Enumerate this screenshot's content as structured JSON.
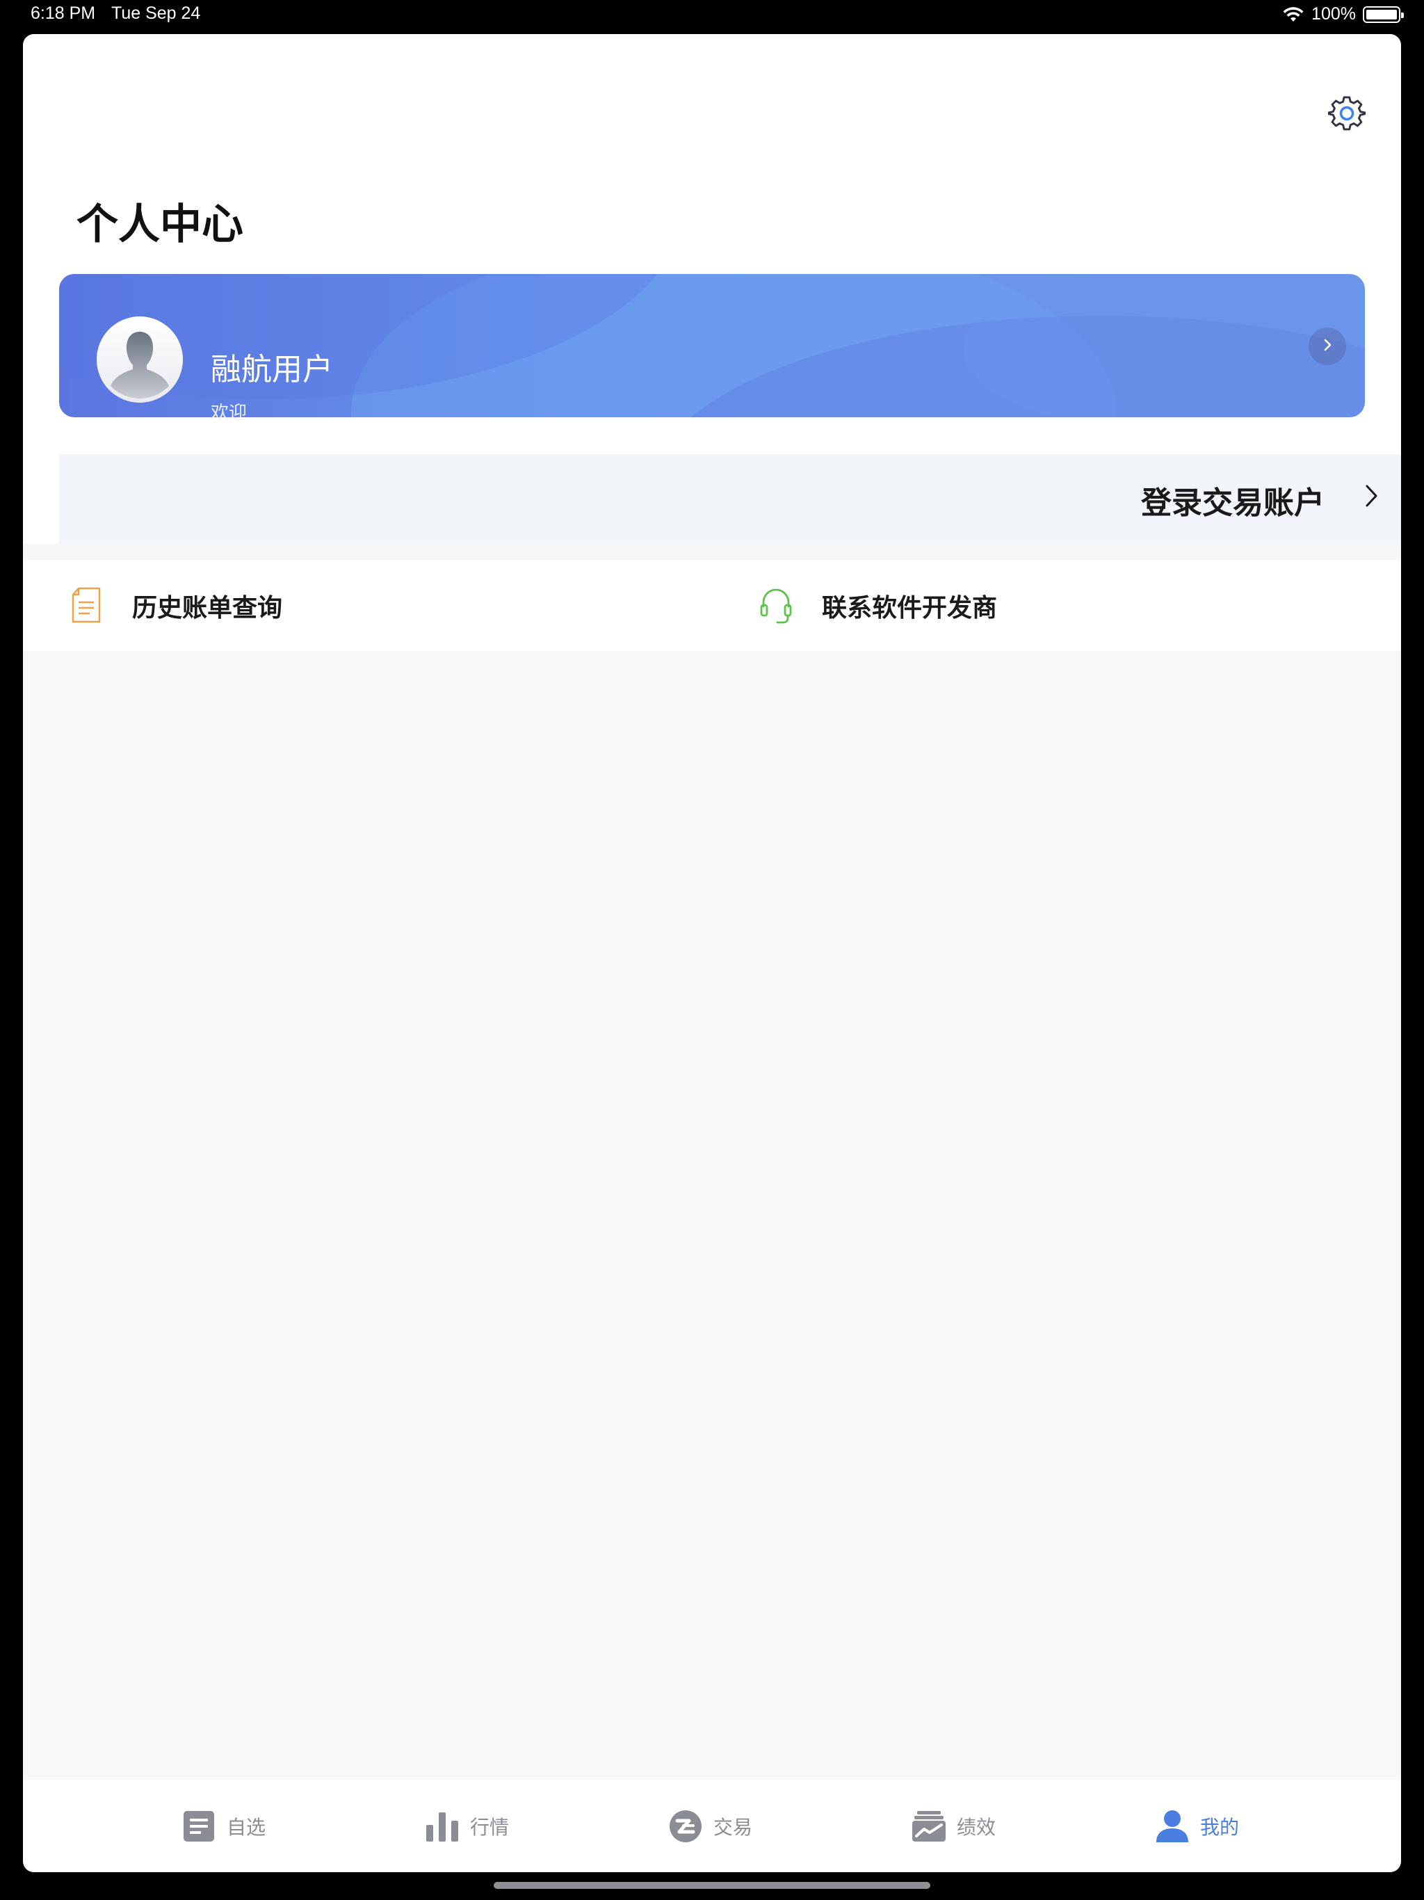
{
  "status_bar": {
    "time": "6:18 PM",
    "date": "Tue Sep 24",
    "battery": "100%"
  },
  "page": {
    "title": "个人中心"
  },
  "profile": {
    "name": "融航用户",
    "subtitle": "欢迎"
  },
  "login": {
    "label": "登录交易账户"
  },
  "menu": {
    "history_bill": "历史账单查询",
    "contact_developer": "联系软件开发商"
  },
  "tabs": [
    {
      "label": "自选",
      "icon": "watchlist-icon",
      "active": false
    },
    {
      "label": "行情",
      "icon": "market-chart-icon",
      "active": false
    },
    {
      "label": "交易",
      "icon": "trade-icon",
      "active": false
    },
    {
      "label": "绩效",
      "icon": "performance-icon",
      "active": false
    },
    {
      "label": "我的",
      "icon": "user-icon",
      "active": true
    }
  ],
  "colors": {
    "accent": "#4a7fe0",
    "card_gradient_start": "#5b76e0",
    "card_gradient_end": "#6a96ea",
    "tab_inactive": "#8a8d94",
    "history_icon": "#f0a24a",
    "contact_icon": "#5cc24a"
  }
}
